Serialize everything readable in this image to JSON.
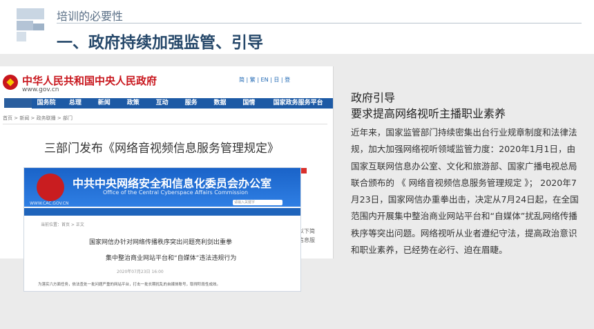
{
  "slide": {
    "section_title": "培训的必要性",
    "main_title": "一、政府持续加强监管、引导"
  },
  "gov_screenshot": {
    "site_name": "中华人民共和国中央人民政府",
    "site_url": "www.gov.cn",
    "toolbar": "简 | 繁 | EN | 日 | 登",
    "nav_items": [
      "国务院",
      "总理",
      "新闻",
      "政策",
      "互动",
      "服务",
      "数据",
      "国情",
      "国家政务服务平台"
    ],
    "breadcrumb": "首页 > 新闻 > 政务联播 > 部门",
    "article_title": "三部门发布《网络音视频信息服务管理规定》",
    "side_text_1": "以下简",
    "side_text_2": "信息服"
  },
  "cac_screenshot": {
    "org_name": "中共中央网络安全和信息化委员会办公室",
    "org_name_en": "Office of the Central Cyberspace Affairs Commission",
    "site_url": "WWW.CAC.GOV.CN",
    "search_placeholder": "请输入关键字",
    "breadcrumb": "当前位置：首页 > 正文",
    "headline_1": "国家网信办针对网络传播秩序突出问题亮利剑出重拳",
    "headline_2": "集中整治商业网站平台和“自媒体”违法违规行为",
    "date": "2020年07月23日 16:00",
    "body_snippet": "为落实六方面任务，依法查处一批问题严重的网站平台，打击一批长期扰乱的自媒体账号，取得阶段性成效。"
  },
  "right_panel": {
    "heading_1": "政府引导",
    "heading_2": "要求提高网络视听主播职业素养",
    "paragraph": "近年来，国家监管部门持续密集出台行业规章制度和法律法规，加大加强网络视听领域监管力度：2020年1月1日，由国家互联网信息办公室、文化和旅游部、国家广播电视总局联合颁布的 《 网络音视频信息服务管理规定 》； 2020年7月23日，国家网信办重拳出击，决定从7月24日起，在全国范围内开展集中整治商业网站平台和“自媒体”扰乱网络传播秩序等突出问题。网络视听从业者遵纪守法，提高政治意识和职业素养，已经势在必行、迫在眉睫。"
  },
  "colors": {
    "title_blue": "#26486a",
    "gov_red": "#c8161d",
    "gov_nav_blue": "#1d5aa5",
    "cac_blue": "#1a63c8",
    "panel_gray": "#ebebeb"
  },
  "icons": [
    "slide-logo-icon",
    "national-emblem-icon",
    "party-emblem-icon",
    "share-icon"
  ]
}
